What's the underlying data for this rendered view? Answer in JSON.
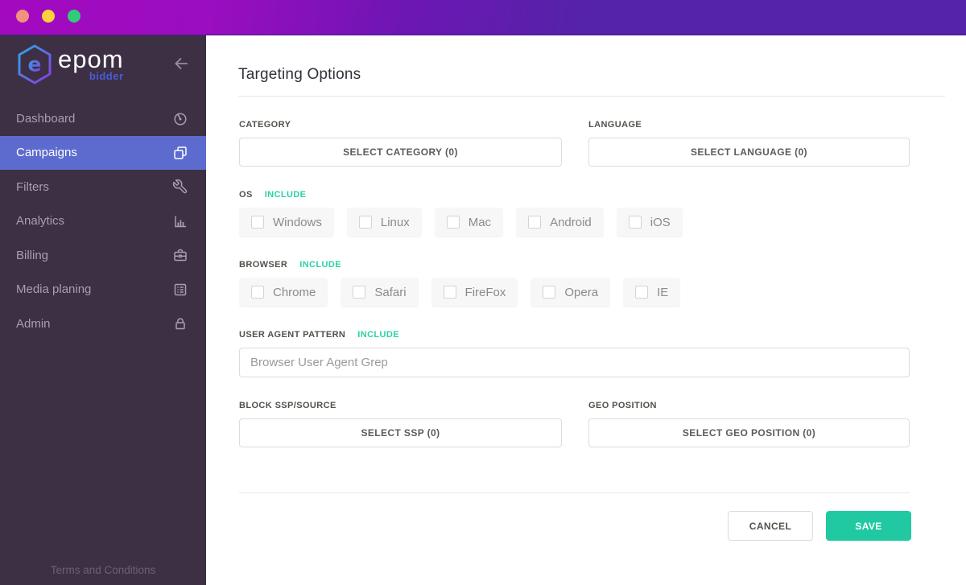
{
  "colors": {
    "topbar_gradient_from": "#a30ac0",
    "topbar_gradient_to": "#5523a8",
    "sidebar_bg": "#3d3044",
    "active_item_bg": "#5d6bce",
    "accent_teal": "#20c9a1",
    "include_teal": "#2bd1a3",
    "traffic_red": "#f4917e",
    "traffic_yellow": "#fbd23c",
    "traffic_green": "#30cd76"
  },
  "sidebar": {
    "logo": {
      "brand": "epom",
      "subtitle": "bidder"
    },
    "collapse_icon": "arrow-left-icon",
    "items": [
      {
        "label": "Dashboard",
        "icon": "gauge-icon",
        "active": false
      },
      {
        "label": "Campaigns",
        "icon": "copy-icon",
        "active": true
      },
      {
        "label": "Filters",
        "icon": "wrench-icon",
        "active": false
      },
      {
        "label": "Analytics",
        "icon": "bar-chart-icon",
        "active": false
      },
      {
        "label": "Billing",
        "icon": "briefcase-icon",
        "active": false
      },
      {
        "label": "Media planing",
        "icon": "list-icon",
        "active": false
      },
      {
        "label": "Admin",
        "icon": "lock-icon",
        "active": false
      }
    ],
    "footer": "Terms and Conditions"
  },
  "main": {
    "title": "Targeting Options",
    "category": {
      "label": "CATEGORY",
      "button": "SELECT CATEGORY (0)",
      "selected_count": 0
    },
    "language": {
      "label": "LANGUAGE",
      "button": "SELECT LANGUAGE (0)",
      "selected_count": 0
    },
    "os": {
      "label": "OS",
      "mode": "INCLUDE",
      "options": [
        "Windows",
        "Linux",
        "Mac",
        "Android",
        "iOS"
      ],
      "checked": [
        false,
        false,
        false,
        false,
        false
      ]
    },
    "browser": {
      "label": "BROWSER",
      "mode": "INCLUDE",
      "options": [
        "Chrome",
        "Safari",
        "FireFox",
        "Opera",
        "IE"
      ],
      "checked": [
        false,
        false,
        false,
        false,
        false
      ]
    },
    "user_agent": {
      "label": "USER AGENT PATTERN",
      "mode": "INCLUDE",
      "placeholder": "Browser User Agent Grep",
      "value": ""
    },
    "block_ssp": {
      "label": "BLOCK SSP/SOURCE",
      "button": "SELECT SSP (0)",
      "selected_count": 0
    },
    "geo": {
      "label": "GEO POSITION",
      "button": "SELECT GEO POSITION (0)",
      "selected_count": 0
    },
    "actions": {
      "cancel": "CANCEL",
      "save": "SAVE"
    }
  }
}
